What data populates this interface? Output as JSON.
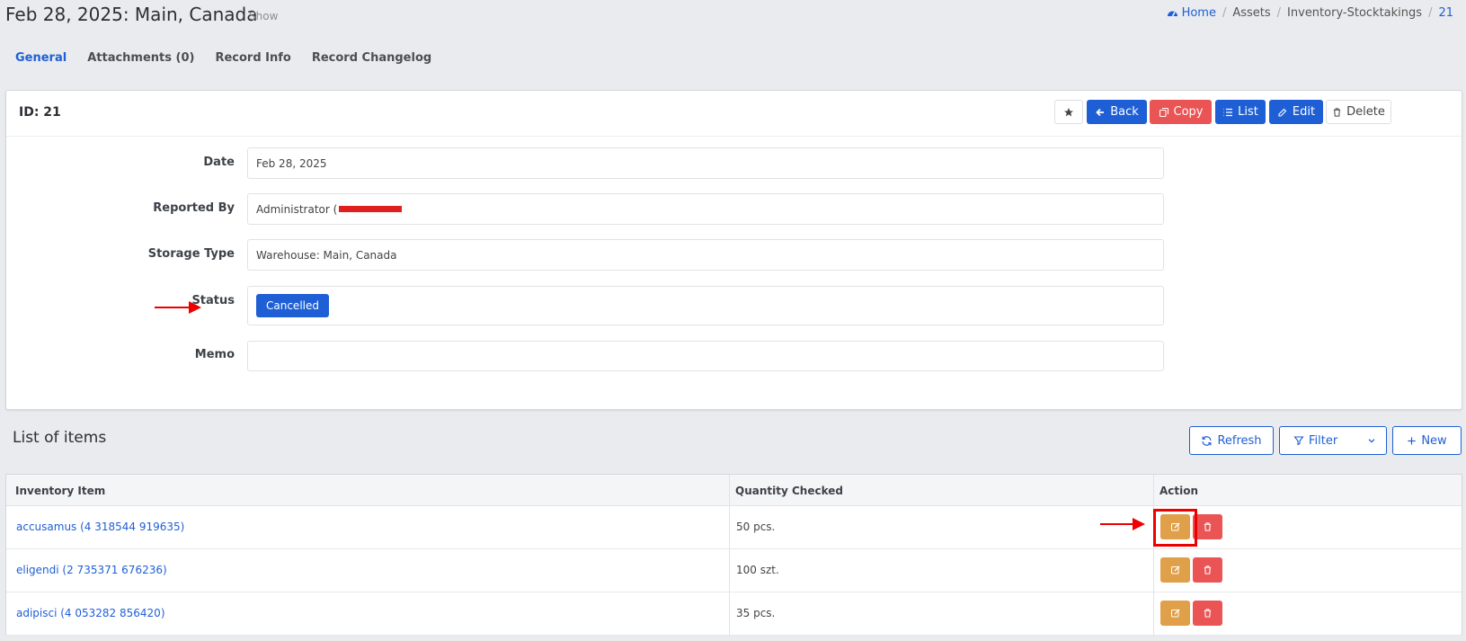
{
  "header": {
    "title": "Feb 28, 2025: Main, Canada",
    "subtitle": "Show",
    "breadcrumb": {
      "home": "Home",
      "items": [
        "Assets",
        "Inventory-Stocktakings"
      ],
      "current": "21"
    }
  },
  "tabs": [
    {
      "label": "General",
      "active": true
    },
    {
      "label": "Attachments (0)"
    },
    {
      "label": "Record Info"
    },
    {
      "label": "Record Changelog"
    }
  ],
  "record": {
    "id_label": "ID: 21",
    "actions": {
      "back": "Back",
      "copy": "Copy",
      "list": "List",
      "edit": "Edit",
      "delete": "Delete"
    },
    "fields": {
      "date": {
        "label": "Date",
        "value": "Feb 28, 2025"
      },
      "reported_by": {
        "label": "Reported By",
        "value": "Administrator ("
      },
      "storage_type": {
        "label": "Storage Type",
        "value": "Warehouse: Main, Canada"
      },
      "status": {
        "label": "Status",
        "value": "Cancelled"
      },
      "memo": {
        "label": "Memo",
        "value": ""
      }
    }
  },
  "items": {
    "title": "List of items",
    "buttons": {
      "refresh": "Refresh",
      "filter": "Filter",
      "new": "New"
    },
    "columns": [
      "Inventory Item",
      "Quantity Checked",
      "Action"
    ],
    "rows": [
      {
        "item": "accusamus (4 318544 919635)",
        "qty": "50 pcs."
      },
      {
        "item": "eligendi (2 735371 676236)",
        "qty": "100 szt."
      },
      {
        "item": "adipisci (4 053282 856420)",
        "qty": "35 pcs."
      }
    ]
  },
  "colors": {
    "primary": "#1f5fd6",
    "danger": "#ea5455",
    "warning": "#e0a04a",
    "annotation": "#ee0000"
  },
  "icons": [
    "dashboard-icon",
    "star-icon",
    "arrow-left-icon",
    "copy-icon",
    "list-icon",
    "edit-icon",
    "trash-icon",
    "refresh-icon",
    "filter-icon",
    "chevron-down-icon",
    "plus-icon"
  ]
}
